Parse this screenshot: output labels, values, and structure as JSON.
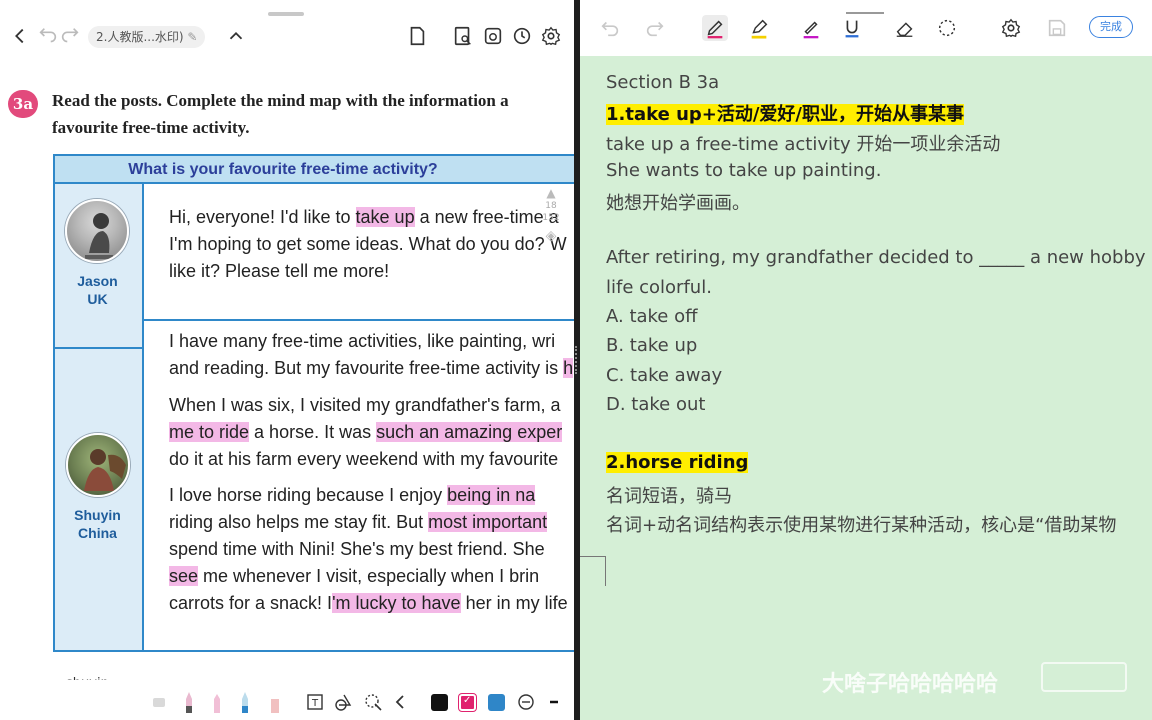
{
  "left_pane": {
    "toolbar": {
      "doc_title": "2.人教版...水印)"
    },
    "exercise": {
      "number": "3a",
      "instruction_line1": "Read the posts. Complete the mind map with the information a",
      "instruction_line2": "favourite free-time activity."
    },
    "book": {
      "header": "What is your favourite free-time activity?",
      "person1": {
        "name": "Jason",
        "country": "UK"
      },
      "person2": {
        "name": "Shuyin",
        "country": "China"
      },
      "post1": [
        [
          "Hi, everyone! I'd like to ",
          "take up",
          " a new free-time a"
        ],
        [
          "I'm hoping to get some ideas. What do you do? W",
          "",
          ""
        ],
        [
          "like it? Please tell me more!",
          "",
          ""
        ]
      ],
      "post2": [
        [
          "I have many free-time activities, like painting, wri",
          "",
          ""
        ],
        [
          "and reading. But my favourite free-time activity is ",
          "h",
          ""
        ],
        [
          "When I was six, I visited my grandfather's farm, a",
          "",
          ""
        ],
        [
          "",
          "me to ride",
          " a horse. It was ",
          "such an amazing exper",
          ""
        ],
        [
          "do it at his farm every weekend with my favourite",
          "",
          ""
        ],
        [
          "I love horse riding because I enjoy ",
          "being in na",
          ""
        ],
        [
          "riding also helps me stay fit. But ",
          "most important",
          ""
        ],
        [
          "spend time with Nini! She's my best friend. She",
          "",
          ""
        ],
        [
          "",
          "see",
          " me whenever I visit, especially when I brin"
        ],
        [
          "carrots for a snack! I",
          "'m lucky to have",
          " her in my life"
        ]
      ],
      "scroll_numbers": [
        "18",
        "152"
      ]
    },
    "author": "shuyin",
    "bottom_colors": [
      "#111111",
      "#e0226e",
      "#2f86c8"
    ]
  },
  "right_pane": {
    "toolbar": {
      "done_label": "完成"
    },
    "notes": {
      "section": "Section B 3a",
      "point1_title": "1.take up+活动/爱好/职业，开始从事某事",
      "point1_ex1": "take up a free-time activity 开始一项业余活动",
      "point1_ex2": "She wants to take up painting.",
      "point1_ex2_cn": "她想开始学画画。",
      "question": "After retiring, my grandfather decided to _____ a new hobby",
      "question_cont": "life colorful.",
      "opt_a": "A. take off",
      "opt_b": "B. take up",
      "opt_c": "C. take away",
      "opt_d": "D. take out",
      "point2_title": "2.horse riding",
      "point2_l1": "名词短语，骑马",
      "point2_l2": "名词+动名词结构表示使用某物进行某种活动，核心是“借助某物"
    },
    "watermark": "大啥子哈哈哈哈哈"
  }
}
